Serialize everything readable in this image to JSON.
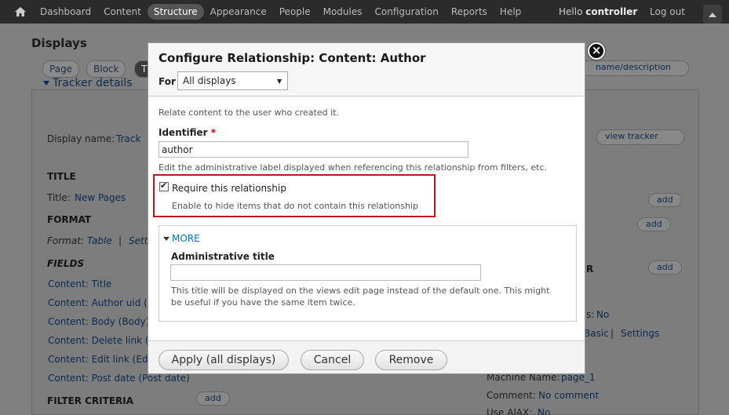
{
  "toolbar": {
    "menu": [
      "Dashboard",
      "Content",
      "Structure",
      "Appearance",
      "People",
      "Modules",
      "Configuration",
      "Reports",
      "Help"
    ],
    "active_item": "Structure",
    "hello": "Hello ",
    "username": "controller",
    "logout": "Log out"
  },
  "background": {
    "page_title": "Displays",
    "display_tabs": [
      "Page",
      "Block",
      "T"
    ],
    "section_title": "Tracker details",
    "display_name_label": "Display name:",
    "display_name_value": "Track",
    "title_heading": "TITLE",
    "title_label": "Title:",
    "title_value": "New Pages",
    "format_heading": "FORMAT",
    "format_label": "Format:",
    "format_table": "Table",
    "format_sep": "|",
    "format_settings": "Sett",
    "fields_heading": "FIELDS",
    "fields": [
      "Content: Title",
      "Content: Author uid (A",
      "Content: Body (Body)",
      "Content: Delete link (D",
      "Content: Edit link (Edi",
      "Content: Post date (Post date)"
    ],
    "filter_heading": "FILTER CRITERIA",
    "add_label": "add",
    "dropdown_value": "name/description",
    "view_tracker": "view tracker",
    "right_r": "R",
    "right_no_label": "s:",
    "right_no": "No",
    "right_basic": "Basic",
    "right_settings": "Settings",
    "machine_name_label": "Machine Name:",
    "machine_name_value": "page_1",
    "comment_label": "Comment:",
    "comment_value": "No comment",
    "use_ajax_label": "Use AJAX:",
    "use_ajax_value": "No"
  },
  "modal": {
    "title": "Configure Relationship: Content: Author",
    "for_label": "For",
    "for_value": "All displays",
    "close_symbol": "×",
    "description": "Relate content to the user who created it.",
    "identifier_label": "Identifier",
    "required_mark": "*",
    "identifier_value": "author",
    "identifier_help": "Edit the administrative label displayed when referencing this relationship from filters, etc.",
    "require_label": "Require this relationship",
    "require_checked": true,
    "require_help": "Enable to hide items that do not contain this relationship",
    "more_label": "MORE",
    "admin_title_label": "Administrative title",
    "admin_title_value": "",
    "admin_title_help_1": "This title will be displayed on the views edit page instead of the default one. This might",
    "admin_title_help_2": "be useful if you have the same item twice.",
    "apply_button": "Apply (all displays)",
    "cancel_button": "Cancel",
    "remove_button": "Remove"
  },
  "colors": {
    "highlight_border": "#c0141c",
    "link_blue": "#0074bd",
    "toolbar_bg": "#2b2b2b",
    "overlay_bg": "#808080"
  }
}
